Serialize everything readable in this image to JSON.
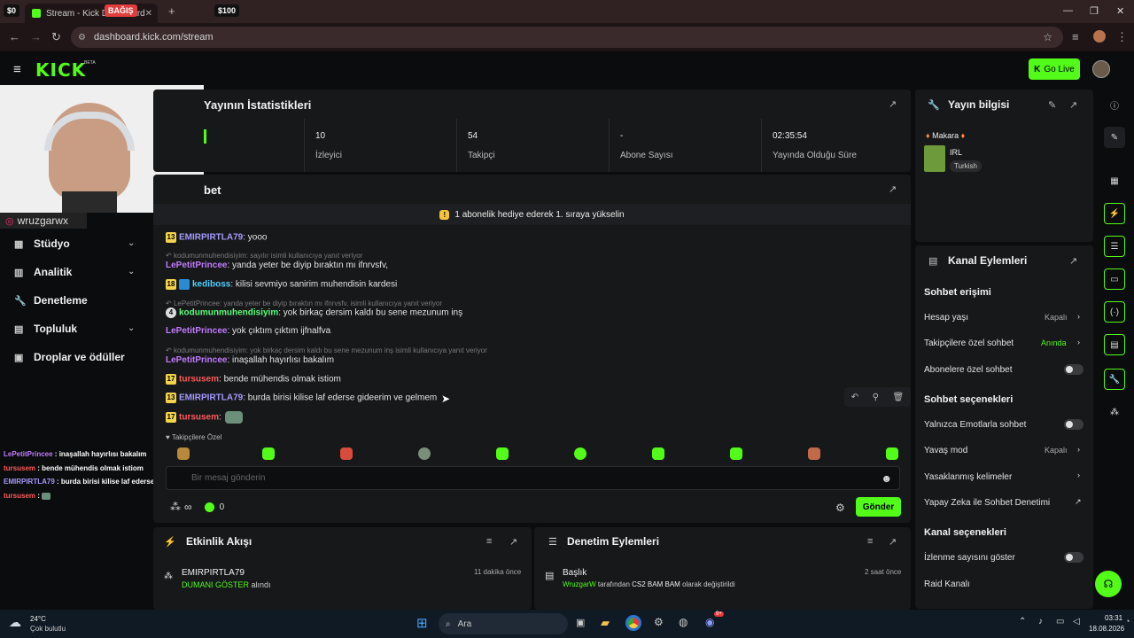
{
  "browser": {
    "tab_title": "Stream - Kick Dashboard",
    "pill_left": "$0",
    "pill_donate": "BAĞIŞ",
    "pill_amount": "$100",
    "new_tab": "+",
    "url": "dashboard.kick.com/stream"
  },
  "header": {
    "logo": "KICK",
    "logo_tag": "BETA",
    "go_live": "Go Live"
  },
  "overlay": {
    "instagram": "wruzgarwx",
    "chat_lines": [
      {
        "user": "LePetitPrincee",
        "text": "inaşallah hayırlısı bakalım",
        "color": "#c27bff"
      },
      {
        "user": "tursusem",
        "text": "bende mühendis olmak istiom",
        "color": "#ff5a5a"
      },
      {
        "user": "EMIRPIRTLA79",
        "text": "burda birisi kilise laf ederse gideerim ve gelmem",
        "color": "#a59bff"
      },
      {
        "user": "tursusem",
        "text": "",
        "color": "#ff5a5a"
      }
    ]
  },
  "sidebar": {
    "items": [
      {
        "label": "Stüdyo",
        "icon": "studio-icon",
        "has_chevron": true
      },
      {
        "label": "Analitik",
        "icon": "chart-icon",
        "has_chevron": true
      },
      {
        "label": "Denetleme",
        "icon": "wrench-icon",
        "has_chevron": false
      },
      {
        "label": "Topluluk",
        "icon": "community-icon",
        "has_chevron": true
      },
      {
        "label": "Droplar ve ödüller",
        "icon": "gift-icon",
        "has_chevron": false
      }
    ]
  },
  "stats": {
    "title": "Yayının İstatistikleri",
    "items": [
      {
        "value": "10",
        "label": "İzleyici"
      },
      {
        "value": "54",
        "label": "Takipçi"
      },
      {
        "value": "-",
        "label": "Abone Sayısı"
      },
      {
        "value": "02:35:54",
        "label": "Yayında Olduğu Süre"
      }
    ]
  },
  "chat": {
    "title": "Sohbet",
    "gift_banner": "1 abonelik hediye ederek 1. sıraya yükselin",
    "followers_only": "Takipçilere Özel",
    "input_placeholder": "Bir mesaj gönderin",
    "infinity": "∞",
    "count": "0",
    "send": "Gönder",
    "messages": [
      {
        "type": "msg",
        "badge": "13",
        "user": "EMIRPIRTLA79",
        "color": "#a59bff",
        "text": ": yooo"
      },
      {
        "type": "reply",
        "text": "kodumunmuhendisiyim: sayılır isimli kullanıcıya yanıt veriyor"
      },
      {
        "type": "msg",
        "badge": "",
        "user": "LePetitPrincee",
        "color": "#c27bff",
        "text": ": yanda yeter be diyip bıraktın mı ifnrvsfv,"
      },
      {
        "type": "msg",
        "badge": "18",
        "user": "kediboss",
        "color": "#4fd1ff",
        "text": ": kilisi sevmiyo sanirim muhendisin kardesi"
      },
      {
        "type": "reply",
        "text": "LePetitPrincee: yanda yeter be diyip bıraktın mı ifnrvsfv, isimli kullanıcıya yanıt veriyor"
      },
      {
        "type": "msg",
        "badge": "4",
        "user": "kodumunmuhendisiyim",
        "color": "#5cff7a",
        "text": ": yok birkaç dersim kaldı bu sene mezunum inş"
      },
      {
        "type": "msg",
        "badge": "",
        "user": "LePetitPrincee",
        "color": "#c27bff",
        "text": ": yok çıktım çıktım ijfnalfva"
      },
      {
        "type": "reply",
        "text": "kodumunmuhendisiyim: yok birkaç dersim kaldı bu sene mezunum inş isimli kullanıcıya yanıt veriyor"
      },
      {
        "type": "msg",
        "badge": "",
        "user": "LePetitPrincee",
        "color": "#c27bff",
        "text": ": inaşallah hayırlısı bakalım"
      },
      {
        "type": "msg",
        "badge": "17",
        "user": "tursusem",
        "color": "#ff5a5a",
        "text": ": bende mühendis olmak istiom"
      },
      {
        "type": "msg",
        "badge": "13",
        "user": "EMIRPIRTLA79",
        "color": "#a59bff",
        "text": ": burda birisi kilise laf ederse gideerim ve gelmem"
      },
      {
        "type": "msg",
        "badge": "17",
        "user": "tursusem",
        "color": "#ff5a5a",
        "text": ":"
      }
    ]
  },
  "stream_info": {
    "title": "Yayın bilgisi",
    "stream_title": "Makara",
    "category": "IRL",
    "language": "Turkish"
  },
  "channel_actions": {
    "title": "Kanal Eylemleri",
    "section_access": "Sohbet erişimi",
    "account_age": "Hesap yaşı",
    "account_age_val": "Kapalı",
    "followers_chat": "Takipçilere özel sohbet",
    "followers_chat_val": "Anında",
    "subs_chat": "Abonelere özel sohbet",
    "section_options": "Sohbet seçenekleri",
    "emotes_only": "Yalnızca Emotlarla sohbet",
    "slow_mode": "Yavaş mod",
    "slow_mode_val": "Kapalı",
    "banned_words": "Yasaklanmış kelimeler",
    "ai_moderation": "Yapay Zeka ile Sohbet Denetimi",
    "section_channel": "Kanal seçenekleri",
    "show_viewers": "İzlenme sayısını göster",
    "raid": "Raid Kanalı"
  },
  "activity": {
    "title": "Etkinlik Akışı",
    "user": "EMIRPIRTLA79",
    "action_item": "DUMANI GÖSTER",
    "action_suffix": "alındı",
    "time": "11 dakika önce"
  },
  "moderation": {
    "title": "Denetim Eylemleri",
    "item_title": "Başlık",
    "user": "WruzgarW",
    "middle": "tarafından",
    "value": "CS2 BAM BAM",
    "suffix": "olarak değiştirildi",
    "time": "2 saat önce"
  },
  "taskbar": {
    "temp": "24°C",
    "weather": "Çok bulutlu",
    "search": "Ara",
    "time": "03:31",
    "date": "18.08.2026",
    "discord_badge": "9+"
  },
  "colors": {
    "accent": "#53fc18",
    "panel": "#17181a",
    "bg": "#0b0c0d"
  }
}
